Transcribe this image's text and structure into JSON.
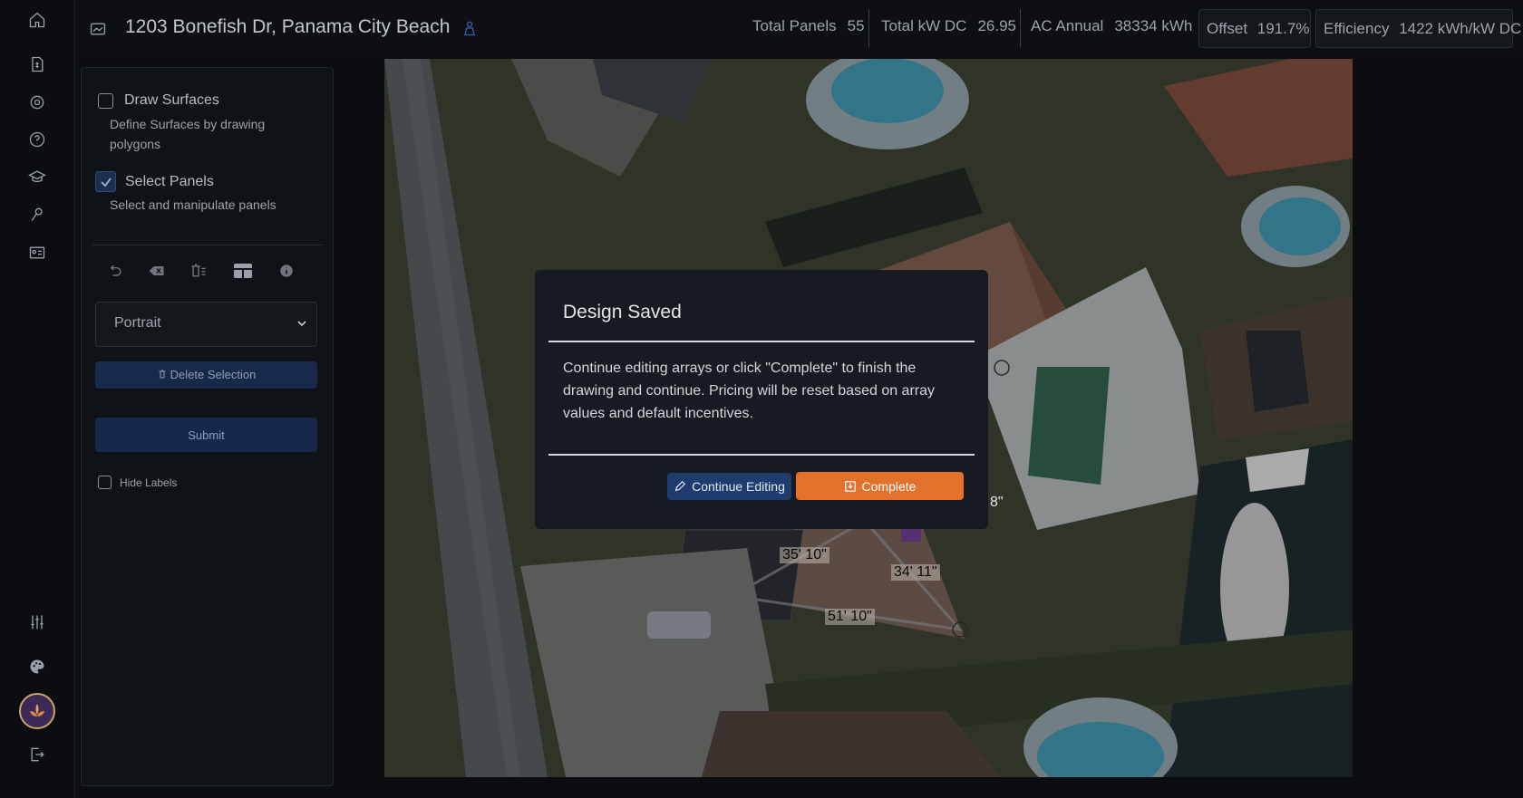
{
  "header": {
    "title": "1203 Bonefish Dr, Panama City Beach",
    "stats": {
      "total_panels_label": "Total Panels",
      "total_panels_value": "55",
      "total_kw_label": "Total kW DC",
      "total_kw_value": "26.95",
      "ac_annual_label": "AC Annual",
      "ac_annual_value": "38334 kWh",
      "offset_label": "Offset",
      "offset_value": "191.7%",
      "efficiency_label": "Efficiency",
      "efficiency_value": "1422 kWh/kW DC"
    }
  },
  "rail": {
    "icons": [
      "home-icon",
      "invoice-icon",
      "settings-icon",
      "help-icon",
      "academy-icon",
      "tools-icon",
      "id-card-icon",
      "sliders-icon",
      "palette-icon",
      "avatar",
      "logout-icon"
    ]
  },
  "panel": {
    "draw_surfaces": {
      "label": "Draw Surfaces",
      "description": "Define Surfaces by drawing polygons",
      "checked": false
    },
    "select_panels": {
      "label": "Select Panels",
      "description": "Select and manipulate panels",
      "checked": true
    },
    "orientation": "Portrait",
    "delete_label": "Delete Selection",
    "submit_label": "Submit",
    "hide_labels": "Hide Labels"
  },
  "map": {
    "dimensions": [
      "35' 10\"",
      "34' 11\"",
      "51' 10\"",
      "8\""
    ]
  },
  "modal": {
    "title": "Design Saved",
    "body": "Continue editing arrays or click \"Complete\" to finish the drawing and continue. Pricing will be reset based on array values and default incentives.",
    "continue_label": "Continue Editing",
    "complete_label": "Complete"
  },
  "colors": {
    "accent_orange": "#e3702b",
    "accent_blue": "#1e3d6e",
    "background": "#0b0d11"
  }
}
